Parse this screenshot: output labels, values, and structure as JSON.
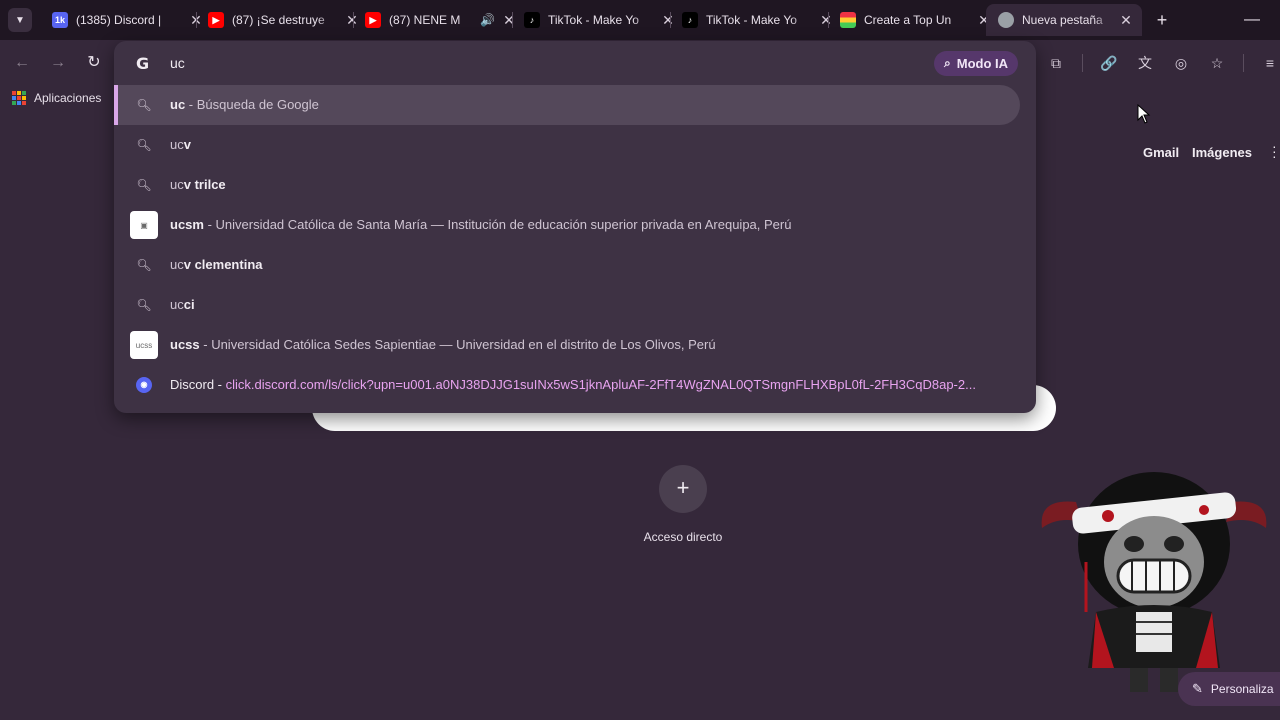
{
  "tabs": [
    {
      "title": "(1385) Discord |",
      "icon": "discord-icon",
      "badge": "1k+",
      "color": "#5865f2",
      "active": false
    },
    {
      "title": "(87) ¡Se destruye",
      "icon": "youtube-icon",
      "color": "#ff0000",
      "active": false
    },
    {
      "title": "(87) NENE M",
      "icon": "youtube-icon",
      "color": "#ff0000",
      "active": false,
      "audio": true
    },
    {
      "title": "TikTok - Make Yo",
      "icon": "tiktok-icon",
      "color": "#000000",
      "active": false
    },
    {
      "title": "TikTok - Make Yo",
      "icon": "tiktok-icon",
      "color": "#000000",
      "active": false
    },
    {
      "title": "Create a Top Un",
      "icon": "tiermaker-icon",
      "color": "#1a1a1a",
      "active": false
    },
    {
      "title": "Nueva pestaña",
      "icon": "chrome-icon",
      "color": "#9aa0a6",
      "active": true
    }
  ],
  "omnibox": {
    "text": "uc",
    "modo_ia_label": "Modo IA",
    "suggestions": [
      {
        "icon": "search-icon",
        "bold": "uc",
        "rest": " - Búsqueda de Google",
        "selected": true
      },
      {
        "icon": "search-icon",
        "plain": "uc",
        "bold": "v",
        "rest": ""
      },
      {
        "icon": "search-icon",
        "plain": "uc",
        "bold": "v trilce",
        "rest": ""
      },
      {
        "icon": "ucsm-logo",
        "bold": "ucsm",
        "rest": " - Universidad Católica de Santa María — Institución de educación superior privada en Arequipa, Perú"
      },
      {
        "icon": "search-icon",
        "plain": "uc",
        "bold": "v clementina",
        "rest": ""
      },
      {
        "icon": "search-icon",
        "plain": "uc",
        "bold": "ci",
        "rest": ""
      },
      {
        "icon": "ucss-logo",
        "bold": "ucss",
        "rest": " - Universidad Católica Sedes Sapientiae — Universidad en el distrito de Los Olivos, Perú"
      },
      {
        "icon": "discord-icon",
        "plain": "Discord - ",
        "url": "click.discord.com/ls/click?upn=u001.a0NJ38DJJG1suINx5wS1jknApluAF-2FfT4WgZNAL0QTSmgnFLHXBpL0fL-2FH3CqD8ap-2..."
      }
    ]
  },
  "bookmarks": {
    "apps_label": "Aplicaciones"
  },
  "header_links": {
    "gmail": "Gmail",
    "imagenes": "Imágenes"
  },
  "shortcut": {
    "label": "Acceso directo"
  },
  "customize": {
    "label": "Personaliza"
  },
  "colors": {
    "background": "#35283a",
    "tabstrip": "#1f1622",
    "accent": "#d9a6e8"
  }
}
